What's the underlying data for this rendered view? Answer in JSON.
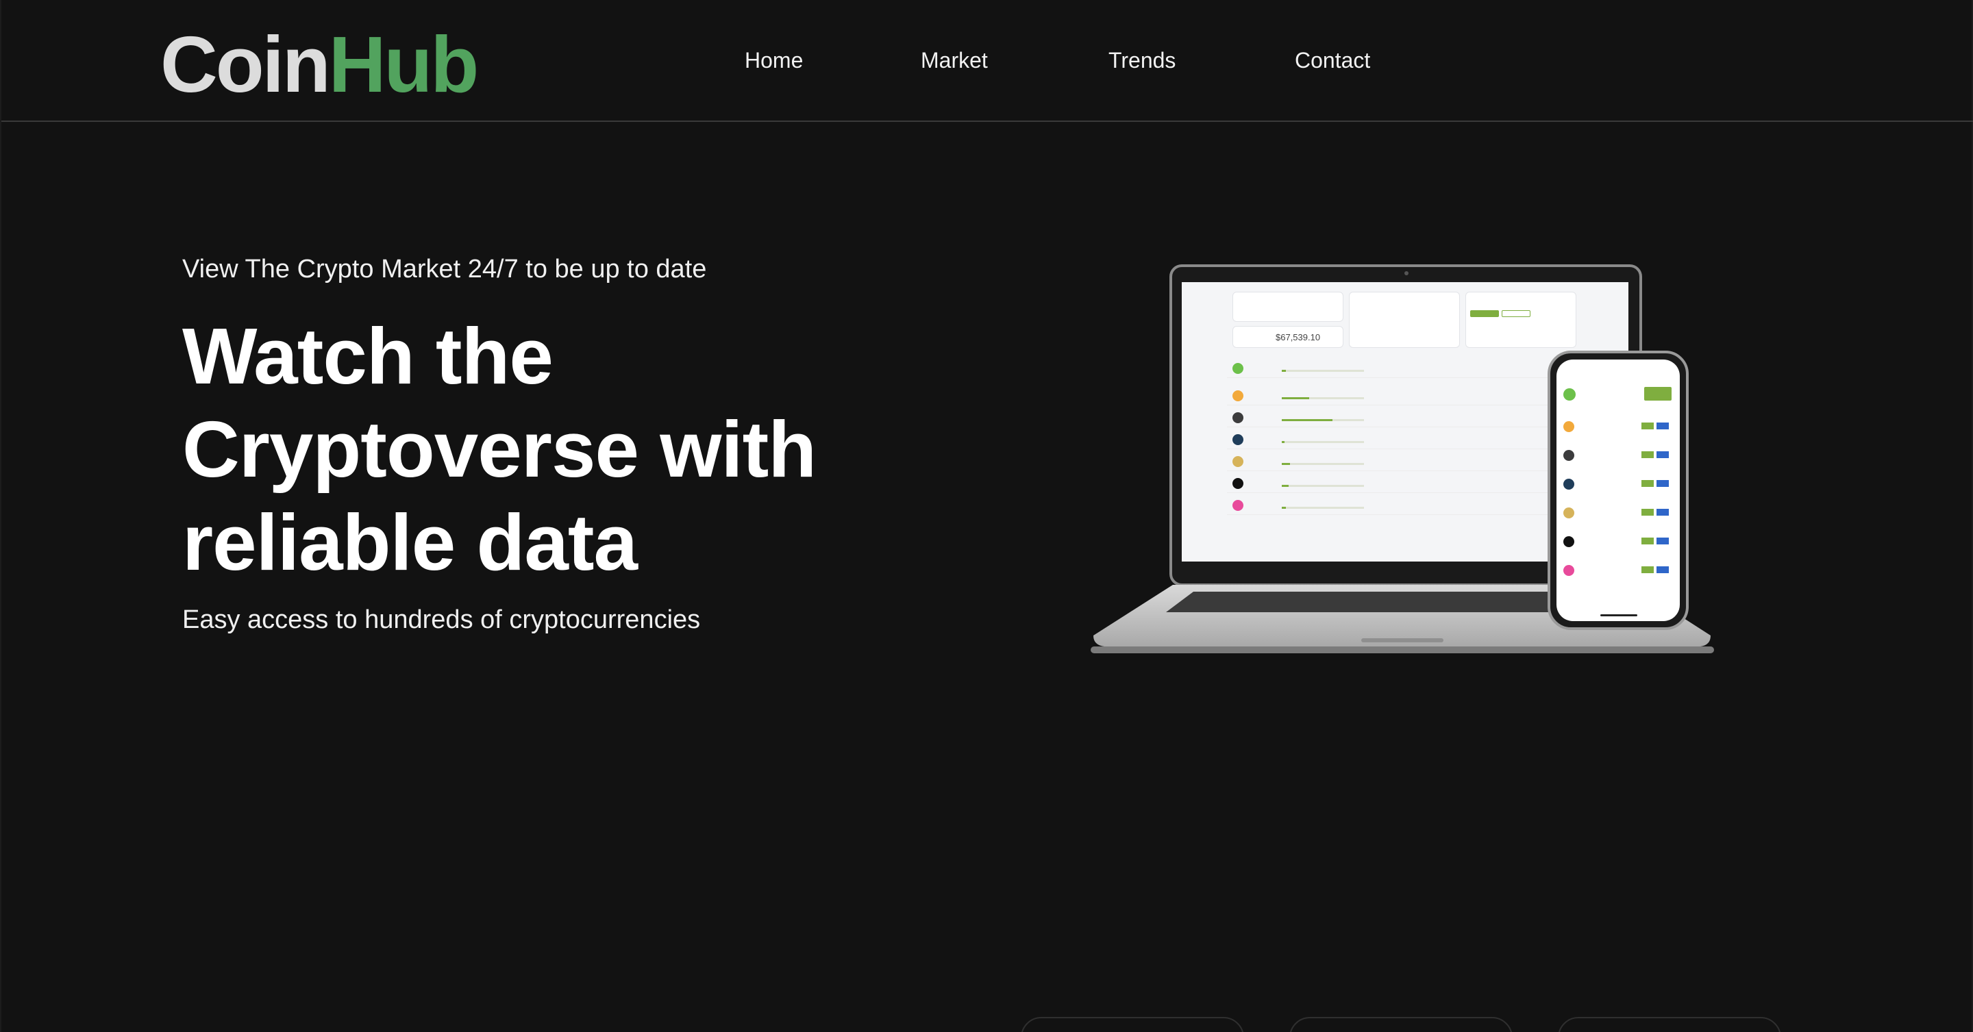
{
  "brand": {
    "part1": "Coin",
    "part2": "Hub"
  },
  "nav": {
    "items": [
      {
        "label": "Home"
      },
      {
        "label": "Market"
      },
      {
        "label": "Trends"
      },
      {
        "label": "Contact"
      }
    ]
  },
  "hero": {
    "eyebrow": "View The Crypto Market 24/7 to be up to date",
    "headline_line1": "Watch the",
    "headline_line2": "Cryptoverse with",
    "headline_line3": "reliable data",
    "subline": "Easy access to hundreds of cryptocurrencies"
  },
  "colors": {
    "background": "#121212",
    "brand_green": "#52a35e",
    "brand_grey": "#dcdcdc",
    "text": "#ffffff"
  },
  "mockup": {
    "portfolio_value": "$67,539.10",
    "coins": [
      {
        "icon": "bitcoin-icon",
        "color": "#f2a93b"
      },
      {
        "icon": "ethereum-icon",
        "color": "#3c3c3d"
      },
      {
        "icon": "cardano-icon",
        "color": "#1f3d5a"
      },
      {
        "icon": "dogecoin-icon",
        "color": "#d6b35a"
      },
      {
        "icon": "polkadot-icon",
        "color": "#111111"
      },
      {
        "icon": "uniswap-icon",
        "color": "#e84a9b"
      }
    ]
  }
}
